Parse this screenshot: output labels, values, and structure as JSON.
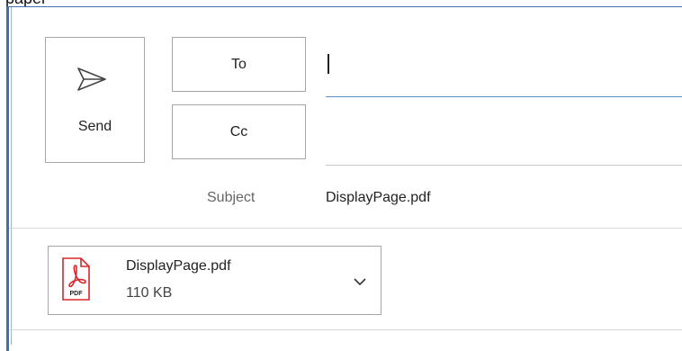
{
  "header": {
    "partial_text": "paper"
  },
  "compose": {
    "send_label": "Send",
    "to_label": "To",
    "cc_label": "Cc",
    "to_value": "",
    "cc_value": "",
    "subject_label": "Subject",
    "subject_value": "DisplayPage.pdf"
  },
  "attachment": {
    "name": "DisplayPage.pdf",
    "size": "110 KB",
    "icon_text": "PDF",
    "icon": "pdf-file-icon"
  },
  "colors": {
    "frame_blue": "#3e6fb0",
    "focus_underline": "#5b8fd0",
    "pdf_red": "#d9262c"
  }
}
